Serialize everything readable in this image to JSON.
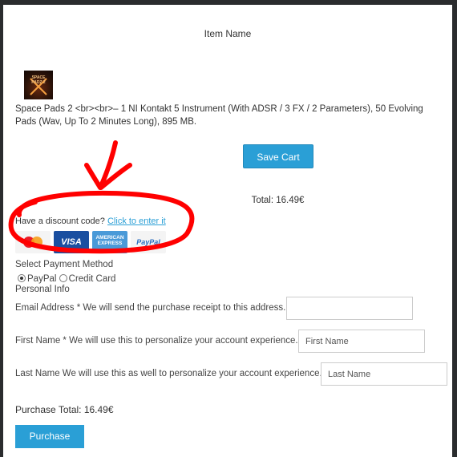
{
  "cart": {
    "column_header": "Item Name",
    "product_thumb_text_1": "SPACE",
    "product_thumb_text_2": "PADZ 2",
    "product_description": "Space Pads 2 <br><br>– 1 NI Kontakt 5 Instrument (With ADSR / 3 FX / 2 Parameters), 50 Evolving Pads (Wav, Up To 2 Minutes Long), 895 MB.",
    "save_label": "Save Cart",
    "total": "Total: 16.49€"
  },
  "discount": {
    "prompt": "Have a discount code?",
    "link_label": "Click to enter it"
  },
  "payment_cards": {
    "visa_label": "VISA",
    "amex_label": "AMERICAN EXPRESS",
    "paypal_label": "PayPal"
  },
  "payment": {
    "heading": "Select Payment Method",
    "options": [
      "PayPal",
      "Credit Card"
    ],
    "selected": "PayPal"
  },
  "personal_info": {
    "heading": "Personal Info",
    "email_label": "Email Address * We will send the purchase receipt to this address.",
    "email_value": "",
    "first_name_label": "First Name * We will use this to personalize your account experience.",
    "first_name_placeholder": "First Name",
    "last_name_label": "Last Name We will use this as well to personalize your account experience.",
    "last_name_placeholder": "Last Name"
  },
  "checkout": {
    "purchase_total": "Purchase Total: 16.49€",
    "purchase_label": "Purchase"
  },
  "colors": {
    "accent": "#2a9fd6",
    "annotation": "#ff0000",
    "frame": "#2a2c2e"
  }
}
